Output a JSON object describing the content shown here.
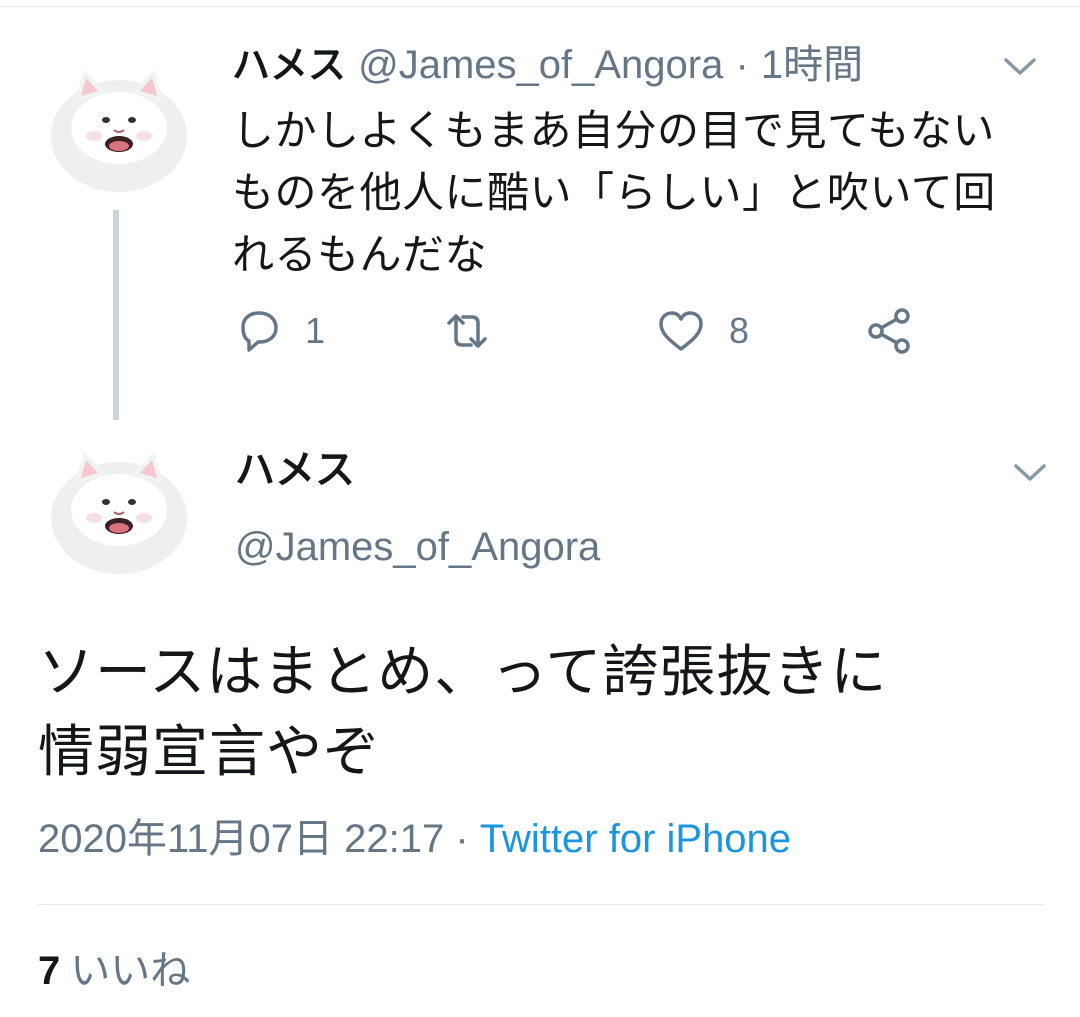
{
  "parent_tweet": {
    "name": "ハメス",
    "handle": "@James_of_Angora",
    "separator": "·",
    "time": "1時間",
    "text_lines": [
      "しかしよくもまあ自分の目で見てもない",
      "ものを他人に酷い「らしい」と吹いて回",
      "れるもんだな"
    ],
    "reply_count": "1",
    "retweet_count": "",
    "like_count": "8",
    "icons": [
      "reply-icon",
      "retweet-icon",
      "like-icon",
      "share-icon",
      "chevron-down-icon"
    ]
  },
  "main_tweet": {
    "name": "ハメス",
    "handle": "@James_of_Angora",
    "text_lines": [
      "ソースはまとめ、って誇張抜きに",
      "情弱宣言やぞ"
    ],
    "timestamp": "2020年11月07日 22:17",
    "separator": "·",
    "source": "Twitter for iPhone",
    "likes_count": "7",
    "likes_label": "いいね"
  },
  "colors": {
    "text": "#14171a",
    "secondary": "#657786",
    "link": "#1b95e0",
    "thread_line": "#cbd6dc",
    "divider": "#e1e8ed"
  }
}
